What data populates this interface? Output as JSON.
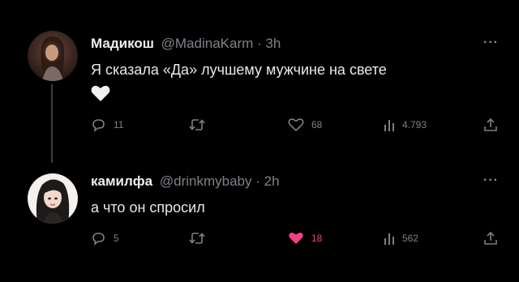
{
  "tweets": [
    {
      "author_name": "Мадикош",
      "handle": "@MadinaKarm",
      "separator": "·",
      "time": "3h",
      "more_icon": "more-dots-icon",
      "text": "Я сказала «Да» лучшему мужчине на свете",
      "emoji": "white-heart-icon",
      "replies": "11",
      "retweets": "",
      "likes": "68",
      "views": "4.793",
      "liked": false
    },
    {
      "author_name": "камилфа",
      "handle": "@drinkmybaby",
      "separator": "·",
      "time": "2h",
      "more_icon": "more-dots-icon",
      "text": "а что он спросил",
      "replies": "5",
      "retweets": "",
      "likes": "18",
      "views": "562",
      "liked": true
    }
  ],
  "colors": {
    "background": "#000000",
    "primary_text": "#e7e9ea",
    "secondary_text": "#7d8288",
    "like_active": "#f33d8a",
    "thread_line": "#3a3d40"
  }
}
